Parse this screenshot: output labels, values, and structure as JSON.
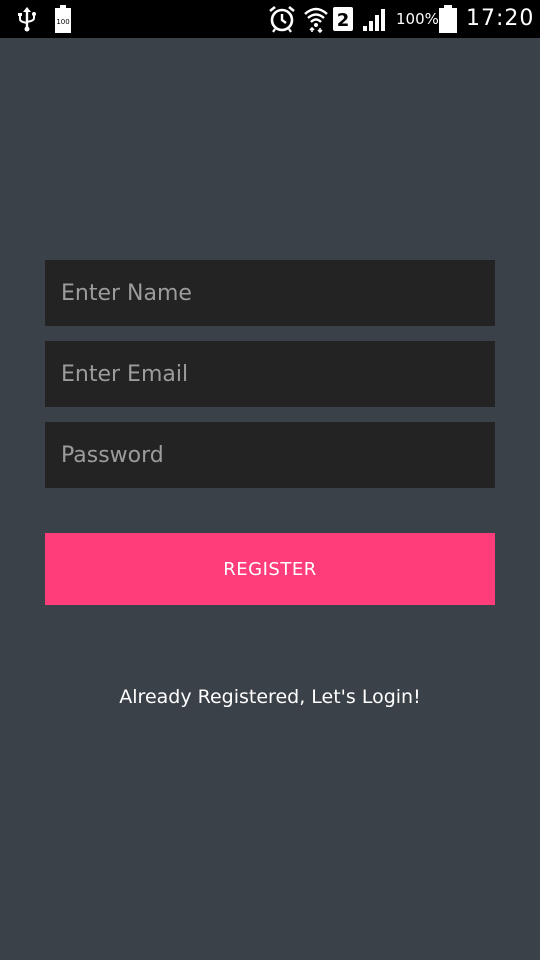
{
  "status_bar": {
    "icons": [
      "usb-icon",
      "battery-saver-icon",
      "alarm-icon",
      "wifi-icon",
      "sim-2-icon",
      "signal-icon",
      "battery-icon"
    ],
    "battery_saver_text": "100",
    "sim_label": "2",
    "battery_percent": "100%",
    "time": "17:20"
  },
  "form": {
    "name_placeholder": "Enter Name",
    "email_placeholder": "Enter Email",
    "password_placeholder": "Password",
    "name_value": "",
    "email_value": "",
    "password_value": ""
  },
  "actions": {
    "register_label": "REGISTER",
    "login_link_label": "Already Registered, Let's Login!"
  },
  "colors": {
    "background": "#3b4148",
    "field_background": "#232323",
    "placeholder": "#9c9c9c",
    "accent": "#ff3d7a",
    "status_bar": "#000000"
  }
}
